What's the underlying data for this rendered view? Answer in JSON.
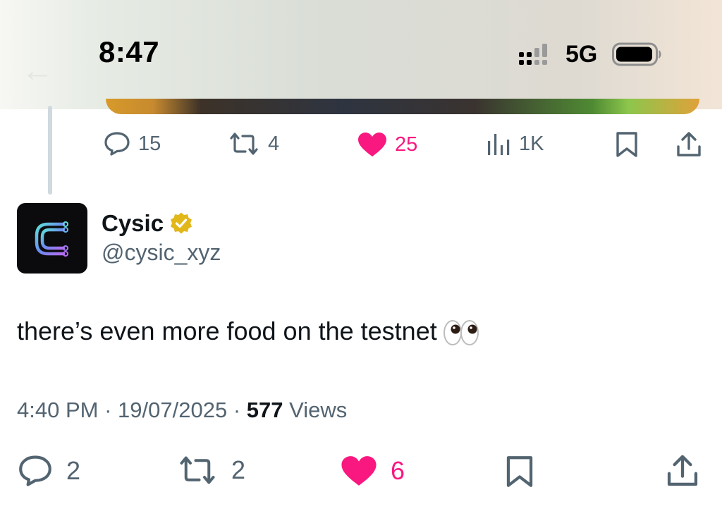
{
  "status_bar": {
    "time": "8:47",
    "network": "5G"
  },
  "previous_post": {
    "replies": "15",
    "reposts": "4",
    "likes": "25",
    "views": "1K"
  },
  "post": {
    "author": {
      "display_name": "Cysic",
      "handle": "@cysic_xyz"
    },
    "text": "there’s even more food on the testnet",
    "time": "4:40 PM",
    "separator": "·",
    "date": "19/07/2025",
    "views_count": "577",
    "views_label": "Views",
    "replies": "2",
    "reposts": "2",
    "likes": "6"
  },
  "colors": {
    "like_pink": "#f91880",
    "secondary_text": "#536471",
    "thread_line": "#cfd9de",
    "verified_gold": "#e2b719"
  },
  "icons": [
    "reply-icon",
    "repost-icon",
    "like-icon",
    "views-icon",
    "bookmark-icon",
    "share-icon",
    "verified-badge-icon",
    "eyes-emoji"
  ]
}
